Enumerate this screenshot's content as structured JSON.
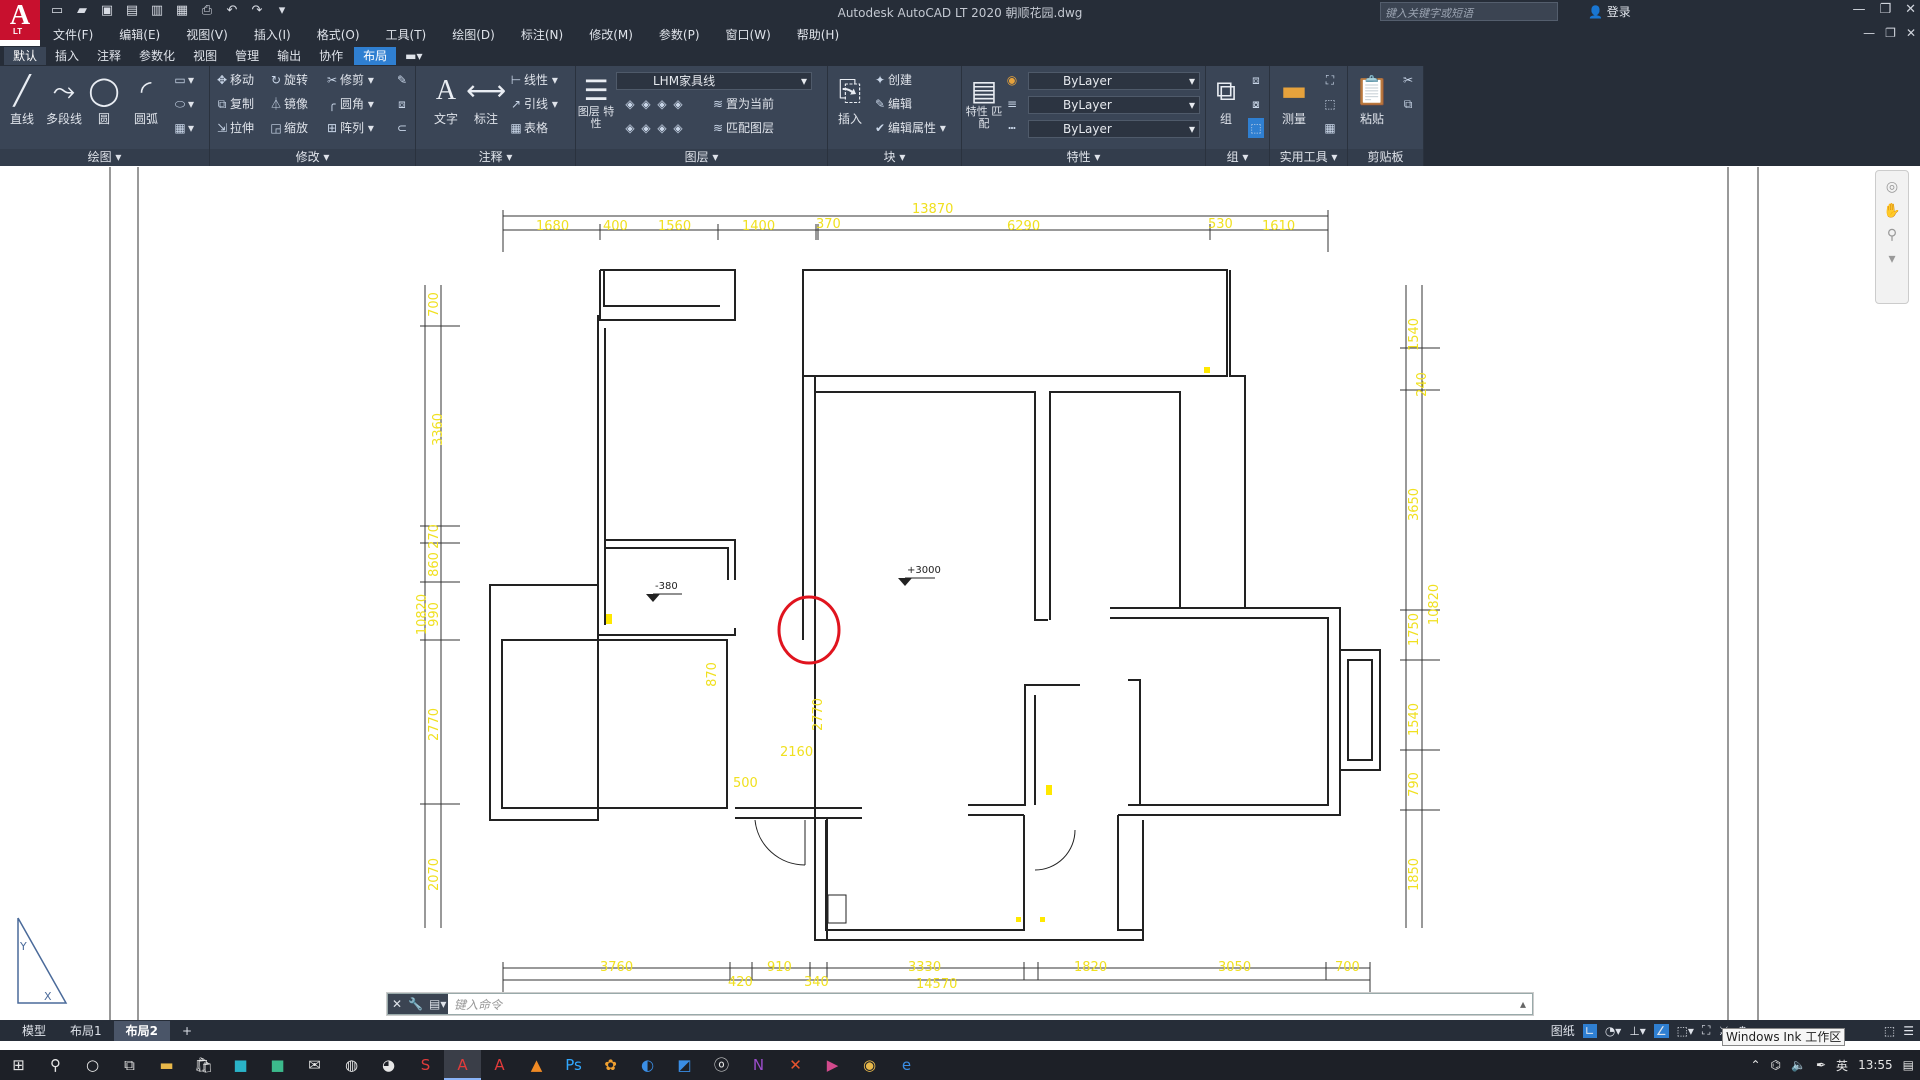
{
  "app": {
    "title": "Autodesk AutoCAD LT 2020    朝顺花园.dwg",
    "logo": "A",
    "logo_sub": "LT",
    "search_placeholder": "键入关键字或短语",
    "signin": "登录"
  },
  "menubar": [
    "文件(F)",
    "编辑(E)",
    "视图(V)",
    "插入(I)",
    "格式(O)",
    "工具(T)",
    "绘图(D)",
    "标注(N)",
    "修改(M)",
    "参数(P)",
    "窗口(W)",
    "帮助(H)"
  ],
  "ribbon_tabs": [
    "默认",
    "插入",
    "注释",
    "参数化",
    "视图",
    "管理",
    "输出",
    "协作",
    "布局"
  ],
  "ribbon": {
    "draw": {
      "title": "绘图",
      "line": "直线",
      "polyline": "多段线",
      "circle": "圆",
      "arc": "圆弧"
    },
    "modify": {
      "title": "修改",
      "move": "移动",
      "rotate": "旋转",
      "trim": "修剪",
      "copy": "复制",
      "mirror": "镜像",
      "fillet": "圆角",
      "stretch": "拉伸",
      "scale": "缩放",
      "array": "阵列"
    },
    "annotation": {
      "title": "注释",
      "text": "文字",
      "dim": "标注",
      "linear": "线性",
      "leader": "引线",
      "table": "表格"
    },
    "layers": {
      "title": "图层",
      "props": "图层\n特性",
      "current_layer": "LHM家具线",
      "set_current": "置为当前",
      "match": "匹配图层"
    },
    "block": {
      "title": "块",
      "insert": "插入",
      "create": "创建",
      "edit": "编辑",
      "edit_attr": "编辑属性"
    },
    "properties": {
      "title": "特性",
      "match": "特性\n匹配",
      "color": "ByLayer",
      "lineweight": "ByLayer",
      "linetype": "ByLayer"
    },
    "groups": {
      "title": "组",
      "group": "组"
    },
    "utilities": {
      "title": "实用工具",
      "measure": "测量"
    },
    "clipboard": {
      "title": "剪贴板",
      "paste": "粘贴"
    }
  },
  "drawing": {
    "dims_top": [
      "1680",
      "400",
      "1560",
      "1400",
      "370",
      "6290",
      "530",
      "1610"
    ],
    "dim_top_total": "13870",
    "dims_bottom": [
      "3760",
      "420",
      "910",
      "340",
      "3330",
      "1820",
      "3050",
      "700"
    ],
    "dim_bottom_total": "14570",
    "dims_left": [
      "700",
      "3360",
      "270",
      "860",
      "990",
      "2770",
      "2070"
    ],
    "dim_left_total": "10820",
    "dims_right": [
      "1540",
      "240",
      "3650",
      "1750",
      "1540",
      "790",
      "1850"
    ],
    "dim_right_total": "10820",
    "inner_dims": [
      "2160",
      "500",
      "2770",
      "870"
    ],
    "level_marks": [
      "-380",
      "+3000"
    ]
  },
  "command": {
    "placeholder": "键入命令"
  },
  "layout_tabs": [
    "模型",
    "布局1",
    "布局2"
  ],
  "active_layout": "布局2",
  "status": {
    "paper": "图纸",
    "ink_tooltip": "Windows Ink 工作区"
  },
  "tray": {
    "ime": "英",
    "time": "13:55"
  }
}
